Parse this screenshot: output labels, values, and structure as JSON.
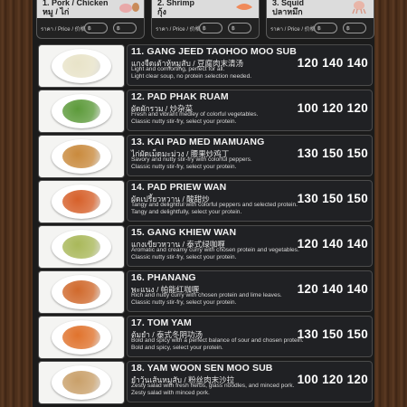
{
  "header": {
    "boxes": [
      {
        "title_en": "1. Pork / Chicken",
        "title_th": "หมู / ไก่",
        "icon": "pig-chicken-icon"
      },
      {
        "title_en": "2. Shrimp",
        "title_th": "กุ้ง",
        "icon": "shrimp-icon"
      },
      {
        "title_en": "3. Squid",
        "title_th": "ปลาหมึก",
        "icon": "squid-icon"
      }
    ],
    "price_label": "ราคา / Price / 价格",
    "currency": "฿"
  },
  "items": [
    {
      "name": "11. GANG JEED TAOHOO MOO SUB",
      "native": "แกงจืดเต้าหู้หมูสับ / 豆腐肉末清汤",
      "desc1": "Light and comforting, perfect for all.",
      "desc2": "Light clear soup, no protein selection needed.",
      "prices": "120 140 140",
      "food_color": "#e8e3c8"
    },
    {
      "name": "12. PAD PHAK RUAM",
      "native": "ผัดผักรวม / 炒杂菜",
      "desc1": "Fresh and vibrant medley of colorful vegetables.",
      "desc2": "Classic nutty stir-fry, select your protein.",
      "prices": "100 120 120",
      "food_color": "#5c9a3a"
    },
    {
      "name": "13. KAI PAD MED MAMUANG",
      "native": "ไก่ผัดเม็ดมะม่วง / 腰果炒鸡丁",
      "desc1": "Savory and nutty stir-fry with colorful peppers.",
      "desc2": "Classic nutty stir-fry, select your protein.",
      "prices": "130 150 150",
      "food_color": "#c98a3d"
    },
    {
      "name": "14. PAD PRIEW WAN",
      "native": "ผัดเปรี้ยวหวาน / 酸甜炒",
      "desc1": "Tangy and delightful with colorful peppers and selected protein.",
      "desc2": "Tangy and delightfully, select your protein.",
      "prices": "130 150 150",
      "food_color": "#d6602a"
    },
    {
      "name": "15. GANG KHIEW WAN",
      "native": "แกงเขียวหวาน / 泰式绿咖喱",
      "desc1": "Aromatic and creamy curry with chosen protein and vegetables.",
      "desc2": "Classic nutty stir-fry, select your protein.",
      "prices": "120 140 140",
      "food_color": "#a9b85a"
    },
    {
      "name": "16. PHANANG",
      "native": "พะแนง / 帕能红咖喱",
      "desc1": "Rich and nutty curry with chosen protein and lime leaves.",
      "desc2": "Classic nutty stir-fry, select your protein.",
      "prices": "120 140 140",
      "food_color": "#d0692c"
    },
    {
      "name": "17. TOM YAM",
      "native": "ต้มยำ / 泰式冬阴功汤",
      "desc1": "Bold and spicy with a perfect balance of sour and chosen protein.",
      "desc2": "Bold and spicy, select your protein.",
      "prices": "130 150 150",
      "food_color": "#e0732d"
    },
    {
      "name": "18. YAM WOON SEN MOO SUB",
      "native": "ยำวุ้นเส้นหมูสับ / 粉丝肉末沙拉",
      "desc1": "Zesty salad with fresh herbs, glass noodles, and minced pork.",
      "desc2": "Zesty salad with minced pork.",
      "prices": "100 120 120",
      "food_color": "#c9a06a"
    }
  ]
}
